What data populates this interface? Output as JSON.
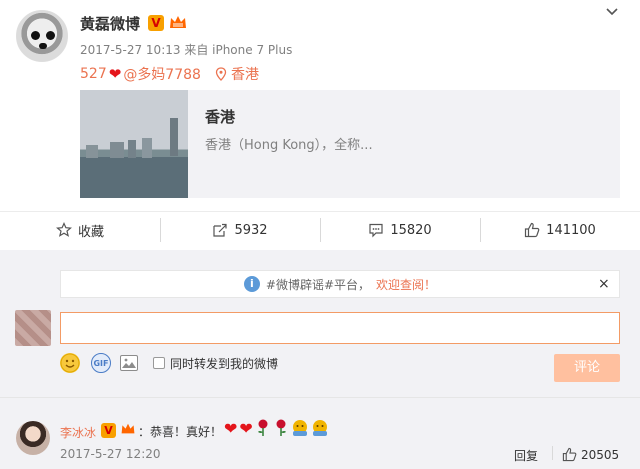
{
  "post": {
    "author": "黄磊微博",
    "verified_badge": "V",
    "meta": "2017-5-27 10:13 来自 iPhone 7 Plus",
    "text_prefix": "527",
    "heart": "❤",
    "mention": "@多妈7788",
    "location": "香港",
    "card": {
      "title": "香港",
      "description": "香港（Hong Kong），全称..."
    }
  },
  "actions": {
    "favorite": "收藏",
    "repost_count": "5932",
    "comment_count": "15820",
    "like_count": "141100"
  },
  "comment_panel": {
    "notice_text": "#微博辟谣#平台，",
    "notice_link": "欢迎查阅！",
    "close": "×",
    "gif": "GIF",
    "forward_label": "同时转发到我的微博",
    "submit": "评论"
  },
  "comment": {
    "author": "李冰冰",
    "verified_badge": "V",
    "text": "：恭喜！真好！",
    "time": "2017-5-27 12:20",
    "reply": "回复",
    "like_count": "20505"
  },
  "icons": {
    "favorite": "star-outline-icon",
    "repost": "repost-icon",
    "comment": "comment-icon",
    "like": "thumbs-up-icon",
    "info": "info-icon",
    "location": "location-pin-icon"
  },
  "colors": {
    "accent": "#eb7350",
    "submit_bg": "#ffc09f",
    "panel_bg": "#f2f2f5"
  }
}
